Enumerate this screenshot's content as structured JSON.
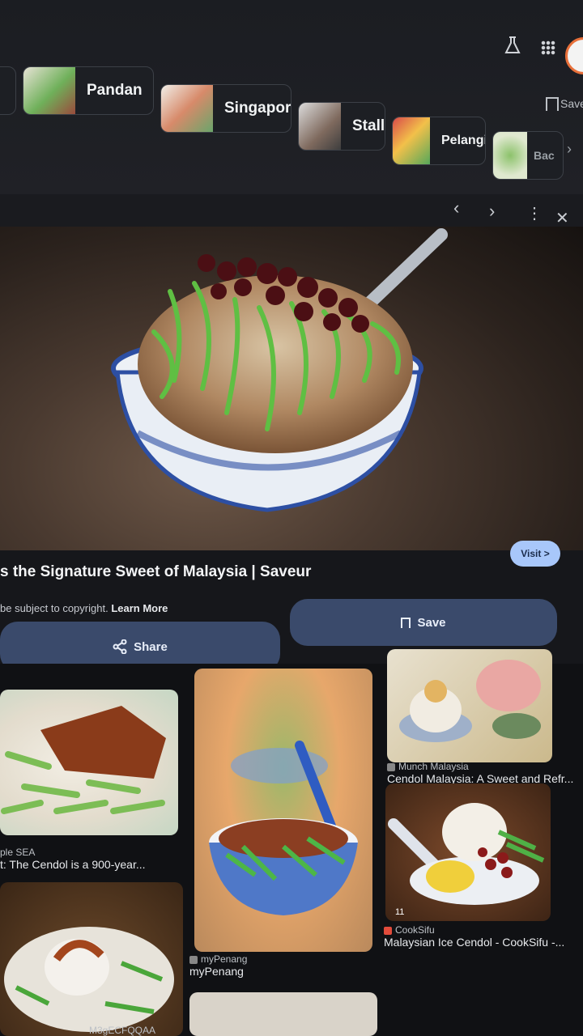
{
  "header": {
    "labs_icon": "flask-icon",
    "apps_icon": "grid-dots-icon",
    "save_label": "Save"
  },
  "chips": [
    {
      "label": "Pandan"
    },
    {
      "label": "Singapore"
    },
    {
      "label": "Stall"
    },
    {
      "label": "Pelangi"
    },
    {
      "label": "Bac"
    }
  ],
  "viewer": {
    "title": "s the Signature Sweet of Malaysia | Saveur",
    "copyright": "be subject to copyright.",
    "learn_more": "Learn More",
    "visit_label": "Visit >",
    "save_label": "Save",
    "share_label": "Share"
  },
  "results": [
    {
      "source": "ple SEA",
      "caption": "t: The Cendol is a 900-year..."
    },
    {
      "source": "myPenang",
      "caption": "myPenang"
    },
    {
      "source": "Munch Malaysia",
      "caption": "Cendol Malaysia: A Sweet and Refr..."
    },
    {
      "source": "CookSifu",
      "caption": "Malaysian Ice Cendol - CookSifu -..."
    },
    {
      "source": "",
      "caption": "M3gECFQQAA"
    }
  ],
  "colors": {
    "accent": "#a8c7fa",
    "pill": "#3a4a6b",
    "bg": "#16171b"
  }
}
